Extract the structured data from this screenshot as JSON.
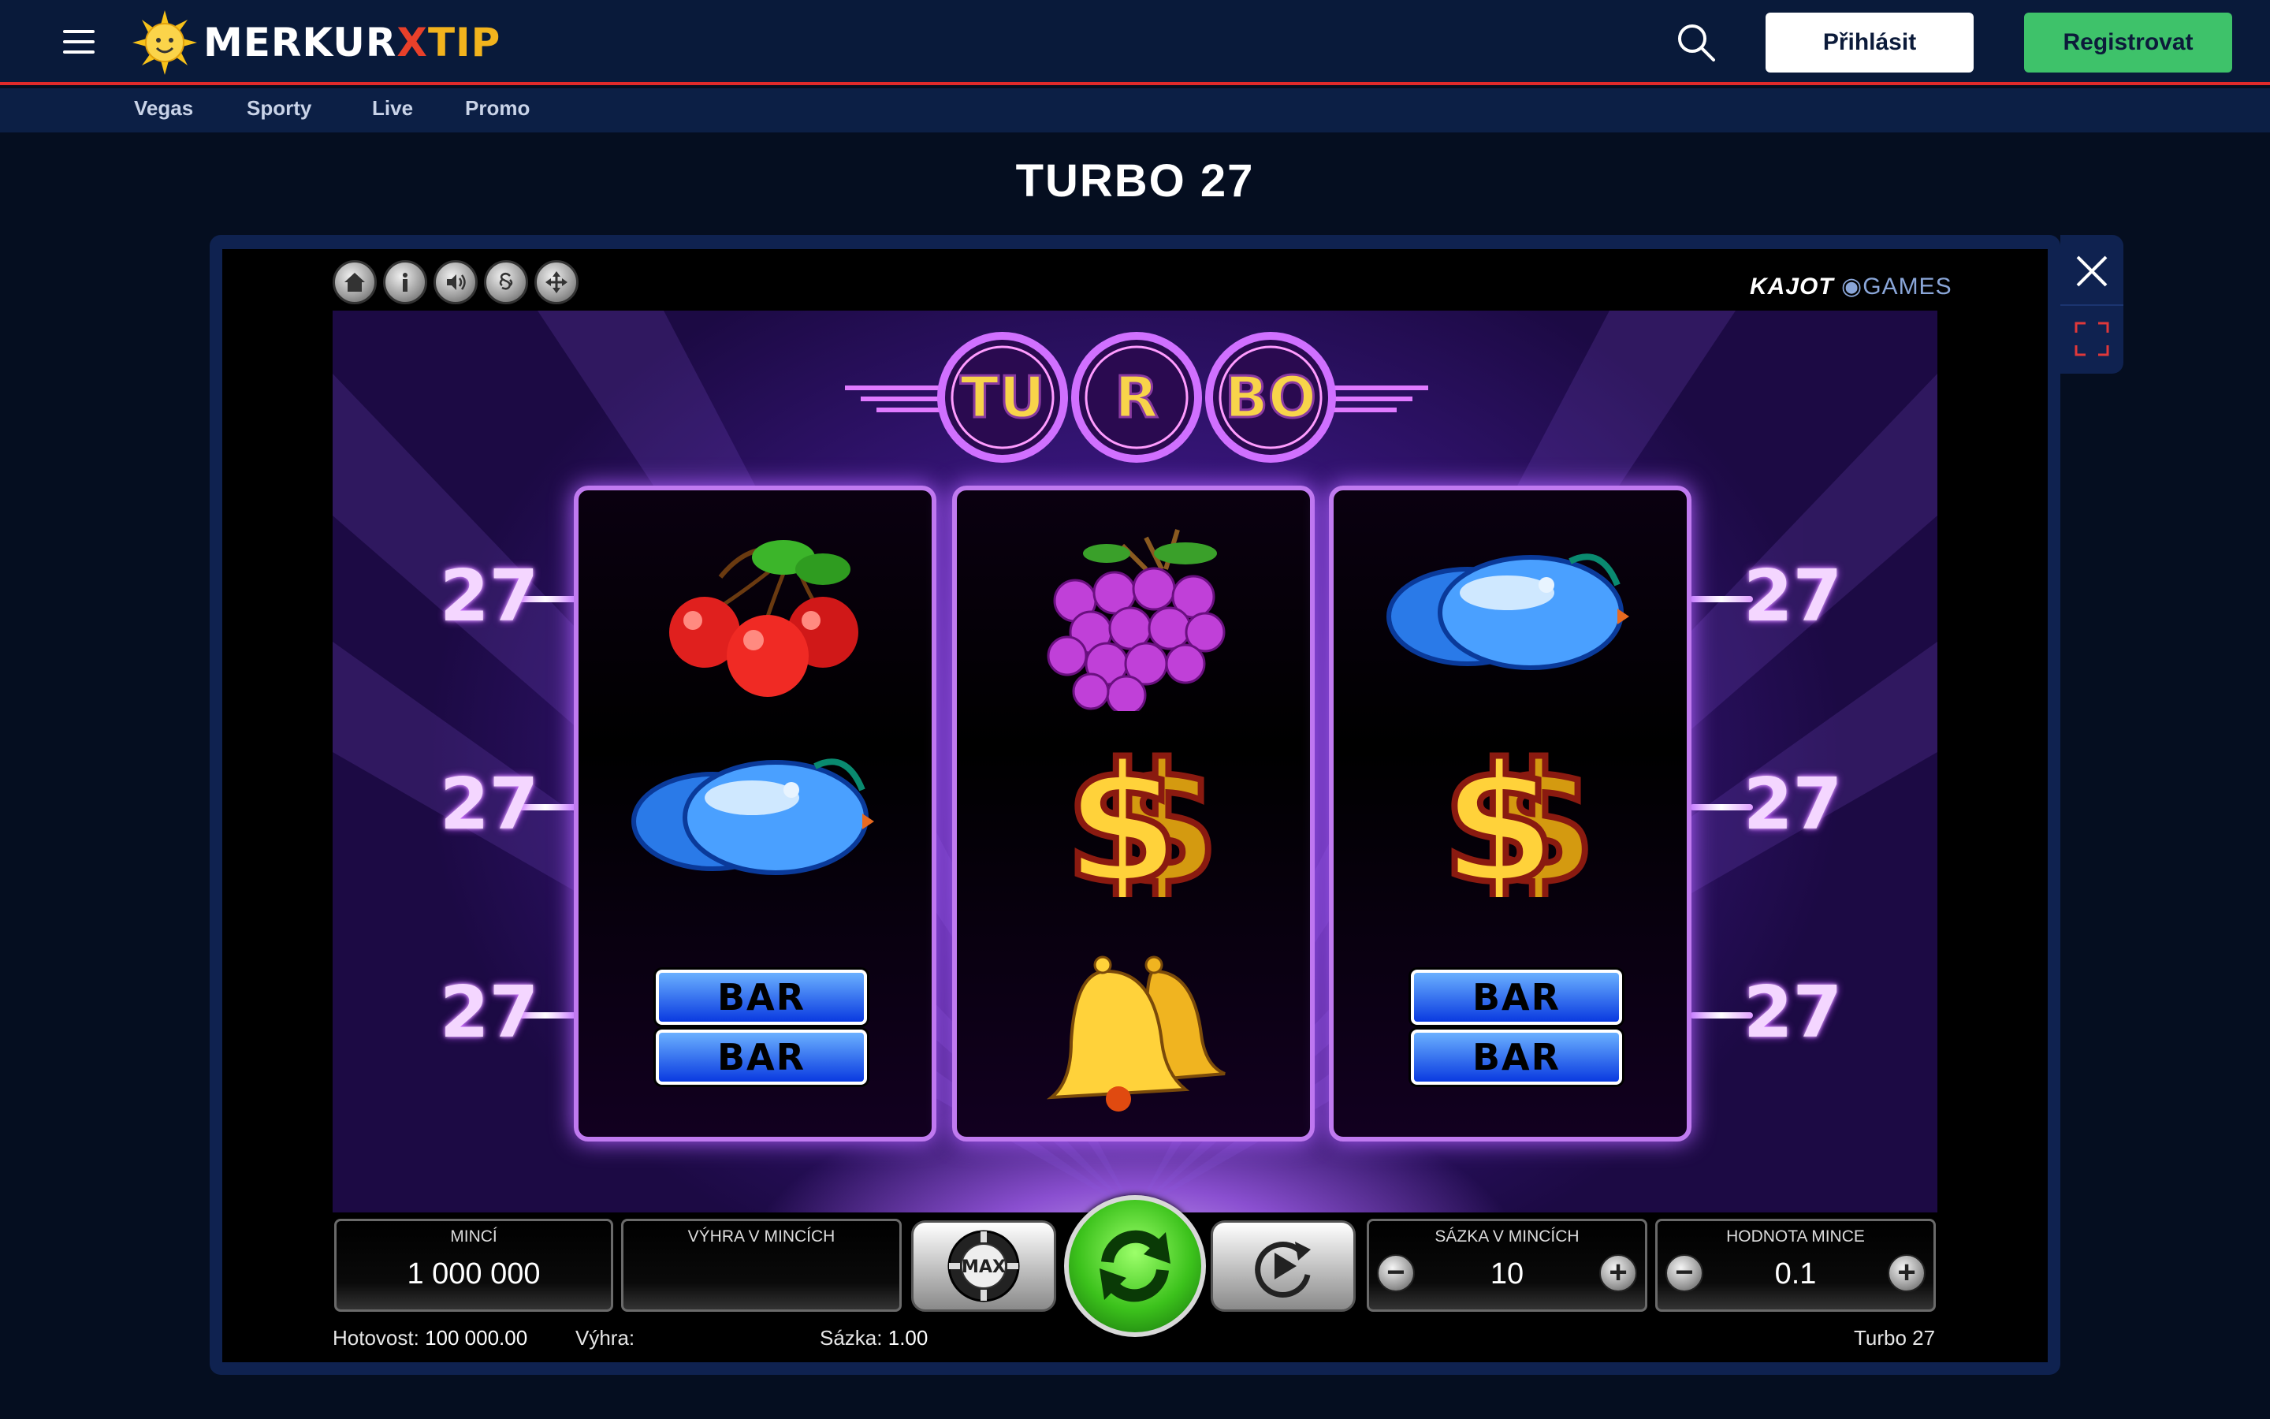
{
  "header": {
    "logo": {
      "word1": "MERKUR",
      "word2": "X",
      "word3": "TIP"
    },
    "login_label": "Přihlásit",
    "register_label": "Registrovat",
    "colors": {
      "brand_bg": "#091a3a",
      "accent_red": "#e02a2a",
      "register_green": "#3ec26a"
    }
  },
  "subnav": {
    "items": [
      "Vegas",
      "Sporty",
      "Live",
      "Promo"
    ]
  },
  "page": {
    "title": "TURBO 27"
  },
  "game": {
    "provider": {
      "name": "KAJOT",
      "suffix": "GAMES"
    },
    "turbo_logo": [
      "TU",
      "R",
      "BO"
    ],
    "top_icons": [
      "home-icon",
      "info-icon",
      "sound-icon",
      "paragraph-icon",
      "move-icon"
    ],
    "line_numbers": [
      "27",
      "27",
      "27",
      "27",
      "27",
      "27"
    ],
    "reels": [
      [
        "cherries",
        "plum",
        "bar-bar"
      ],
      [
        "grapes",
        "dollar",
        "bells"
      ],
      [
        "plum",
        "dollar",
        "bar-bar"
      ]
    ],
    "bar_text": "BAR",
    "max_label": "MAX",
    "controls": {
      "coins": {
        "label": "MINCÍ",
        "value": "1 000 000"
      },
      "win_coins": {
        "label": "VÝHRA V MINCÍCH",
        "value": ""
      },
      "bet_coins": {
        "label": "SÁZKA V MINCÍCH",
        "value": "10"
      },
      "coin_value": {
        "label": "HODNOTA MINCE",
        "value": "0.1"
      }
    },
    "status": {
      "cash_label": "Hotovost:",
      "cash_value": "100 000.00",
      "win_label": "Výhra:",
      "win_value": "",
      "bet_label": "Sázka:",
      "bet_value": "1.00",
      "game_name": "Turbo 27"
    }
  }
}
